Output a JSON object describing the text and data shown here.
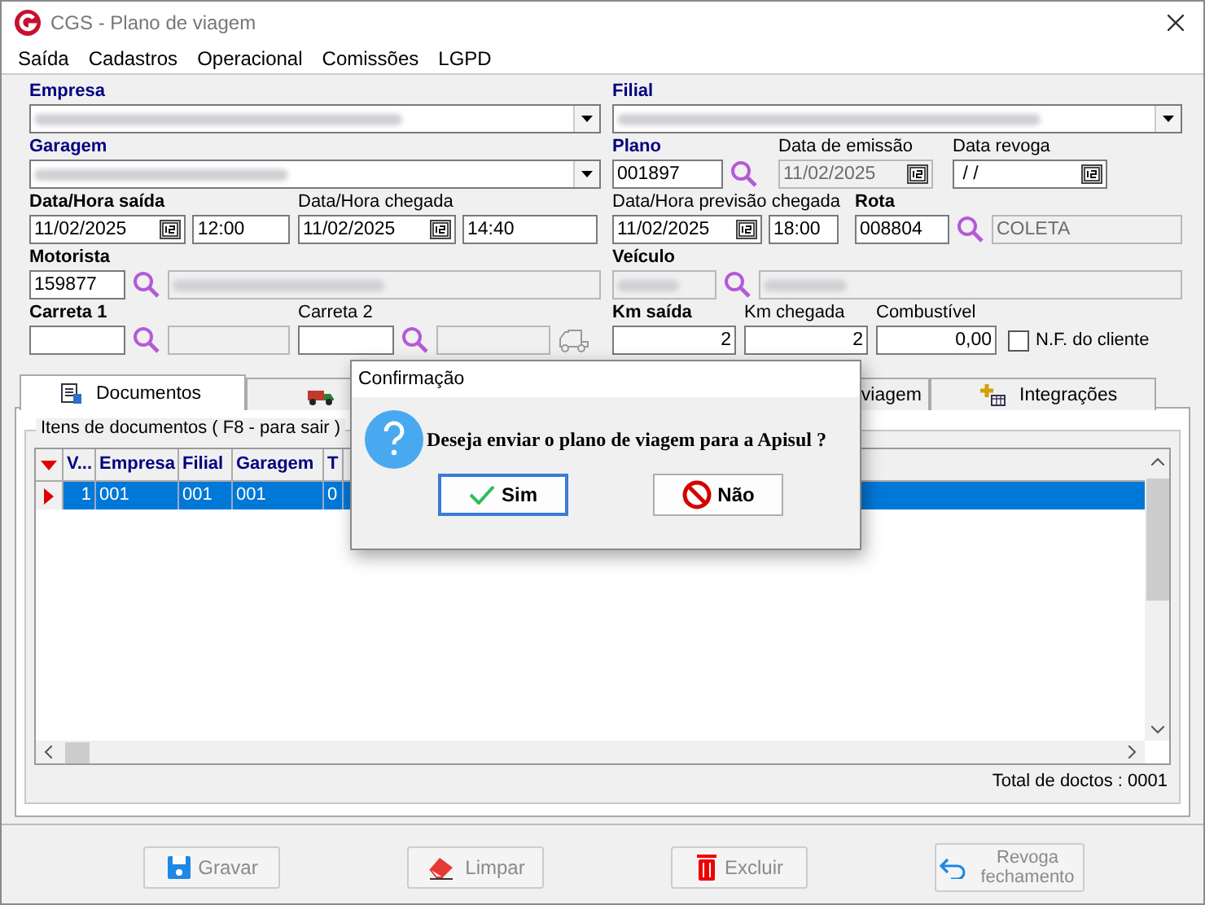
{
  "window": {
    "title": "CGS - Plano de viagem"
  },
  "menu": [
    "Saída",
    "Cadastros",
    "Operacional",
    "Comissões",
    "LGPD"
  ],
  "form": {
    "empresa": {
      "label": "Empresa",
      "required": true,
      "bold": true,
      "redacted": true
    },
    "garagem": {
      "label": "Garagem",
      "required": true,
      "bold": true,
      "redacted": true
    },
    "saida": {
      "label": "Data/Hora saída",
      "required": false,
      "bold": true,
      "date": "11/02/2025",
      "time": "12:00"
    },
    "chegada": {
      "label": "Data/Hora chegada",
      "required": false,
      "bold": false,
      "date": "11/02/2025",
      "time": "14:40"
    },
    "motorista": {
      "label": "Motorista",
      "required": false,
      "bold": true,
      "code": "159877",
      "name_redacted": true
    },
    "carreta_1": {
      "label": "Carreta 1",
      "required": false,
      "bold": true
    },
    "carreta_2": {
      "label": "Carreta 2",
      "required": false,
      "bold": false
    },
    "filial": {
      "label": "Filial",
      "required": true,
      "bold": true,
      "redacted": true
    },
    "plano": {
      "label": "Plano",
      "required": true,
      "bold": true,
      "code": "001897"
    },
    "data_emissao": {
      "label": "Data de emissão",
      "required": false,
      "bold": false,
      "date": "11/02/2025",
      "disabled": true
    },
    "data_revoga": {
      "label": "Data revoga",
      "required": false,
      "bold": false,
      "date": " / /",
      "disabled": false
    },
    "previsao": {
      "label": "Data/Hora previsão chegada",
      "required": false,
      "bold": false,
      "date": "11/02/2025",
      "time": "18:00"
    },
    "rota": {
      "label": "Rota",
      "required": false,
      "bold": true,
      "code": "008804",
      "name": "COLETA"
    },
    "veiculo": {
      "label": "Veículo",
      "required": false,
      "bold": true,
      "code_redacted": true,
      "name_redacted": true
    },
    "km_saida": {
      "label": "Km saída",
      "required": false,
      "bold": true,
      "value": "2"
    },
    "km_chegada": {
      "label": "Km chegada",
      "required": false,
      "bold": false,
      "value": "2"
    },
    "combustivel": {
      "label": "Combustível",
      "required": false,
      "bold": false,
      "value": "0,00"
    },
    "nf_cliente": {
      "label": "N.F. do cliente",
      "checked": false
    }
  },
  "tabs": [
    {
      "label": "Documentos",
      "selected": true
    },
    {
      "selected": false
    },
    {
      "label": "viagem",
      "selected": false
    },
    {
      "label": "Integrações",
      "selected": false
    }
  ],
  "documents": {
    "title": "Itens de documentos ( F8 - para sair )",
    "columns": [
      "V...",
      "Empresa",
      "Filial",
      "Garagem",
      "T"
    ],
    "rows": [
      {
        "selected": true,
        "cells": [
          "1",
          "001",
          "001",
          "001",
          "0"
        ]
      }
    ],
    "total": "Total de doctos : 0001"
  },
  "buttons": [
    {
      "label": "Gravar",
      "disabled": true
    },
    {
      "label": "Limpar",
      "disabled": true
    },
    {
      "label": "Excluir",
      "disabled": true
    },
    {
      "label": "Revoga fechamento",
      "disabled": true
    }
  ],
  "dialog": {
    "title": "Confirmação",
    "message": "Deseja enviar o plano de viagem para a Apisul ?",
    "buttons": [
      {
        "label": "Sim",
        "default": true
      },
      {
        "label": "Não",
        "default": false
      }
    ]
  }
}
